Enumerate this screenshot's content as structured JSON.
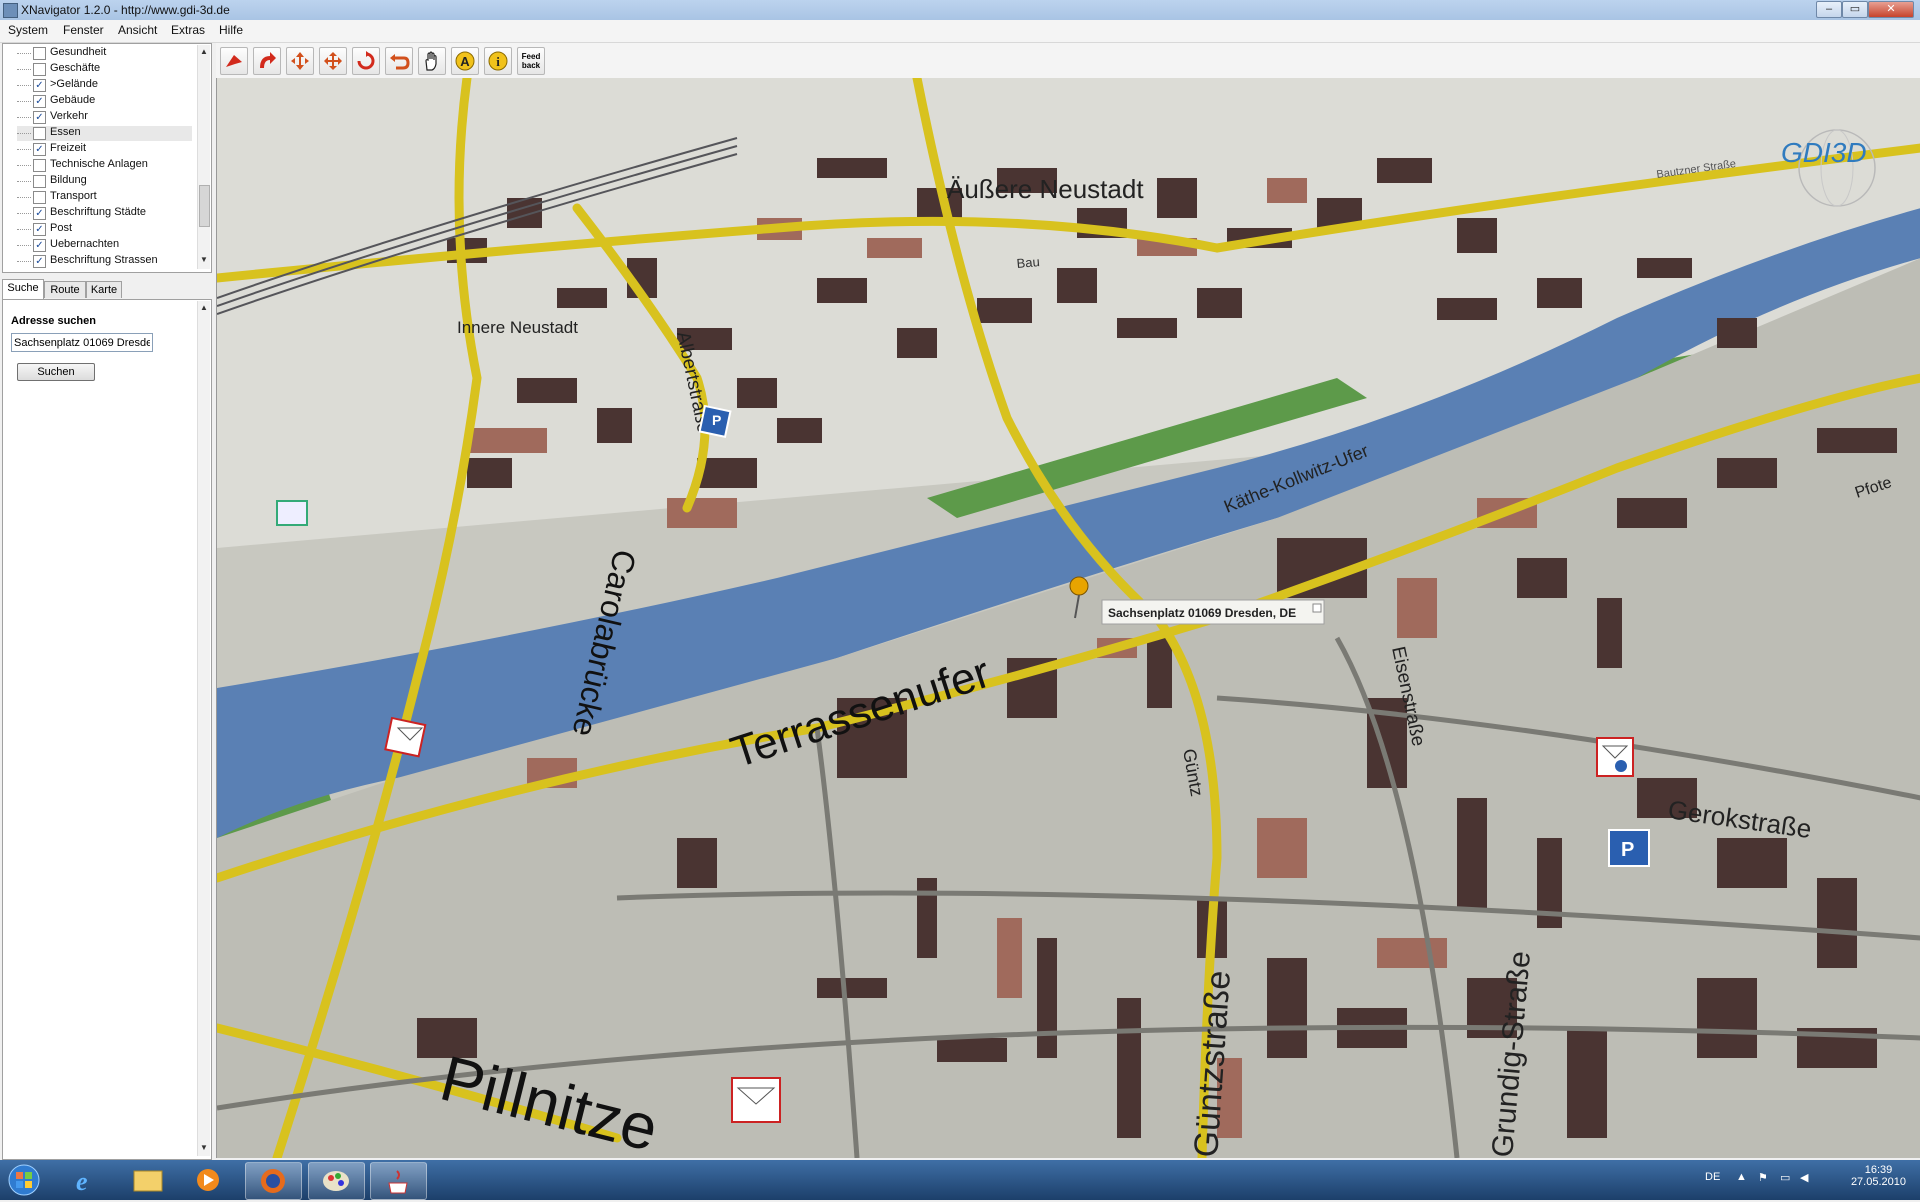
{
  "window": {
    "title": "XNavigator 1.2.0 - http://www.gdi-3d.de"
  },
  "menu": [
    "System",
    "Fenster",
    "Ansicht",
    "Extras",
    "Hilfe"
  ],
  "layers": [
    {
      "label": "Gesundheit",
      "checked": false
    },
    {
      "label": "Geschäfte",
      "checked": false
    },
    {
      "label": ">Gelände",
      "checked": true
    },
    {
      "label": "Gebäude",
      "checked": true
    },
    {
      "label": "Verkehr",
      "checked": true
    },
    {
      "label": "Essen",
      "checked": false,
      "selected": true
    },
    {
      "label": "Freizeit",
      "checked": true
    },
    {
      "label": "Technische Anlagen",
      "checked": false
    },
    {
      "label": "Bildung",
      "checked": false
    },
    {
      "label": "Transport",
      "checked": false
    },
    {
      "label": "Beschriftung Städte",
      "checked": true
    },
    {
      "label": "Post",
      "checked": true
    },
    {
      "label": "Uebernachten",
      "checked": true
    },
    {
      "label": "Beschriftung Strassen",
      "checked": true
    }
  ],
  "tabs": [
    "Suche",
    "Route",
    "Karte"
  ],
  "search": {
    "heading": "Adresse suchen",
    "value": "Sachsenplatz 01069 Dresden, DE",
    "button": "Suchen"
  },
  "toolbar": {
    "feedback_label_1": "Feed",
    "feedback_label_2": "back"
  },
  "map": {
    "logo": "GDI3D",
    "popup": "Sachsenplatz 01069 Dresden, DE",
    "labels": {
      "aussere_neustadt": "Äußere Neustadt",
      "innere_neustadt": "Innere Neustadt",
      "albertstrasse": "Albertstraße",
      "carolabruecke": "Carolabrücke",
      "terrassenufer": "Terrassenufer",
      "kaethe_kollwitz": "Käthe-Kollwitz-Ufer",
      "eisenstrasse": "Eisenstraße",
      "gerokstrasse": "Gerokstraße",
      "grundig": "Grundig-Straße",
      "guentzstrasse": "Güntzstraße",
      "guentz_small": "Güntz",
      "pillnitzer": "Pillnitze",
      "pfotenhauer": "Pfote",
      "bautzner": "Bautzner Straße",
      "bau": "Bau"
    }
  },
  "colors": {
    "river": "#5a80b4",
    "road": "#d8c21e",
    "grass": "#5d9a4a",
    "building": "#4a3432",
    "building_light": "#a06a5c",
    "ground": "#c8c8c0"
  },
  "taskbar": {
    "language": "DE",
    "time": "16:39",
    "date": "27.05.2010"
  }
}
